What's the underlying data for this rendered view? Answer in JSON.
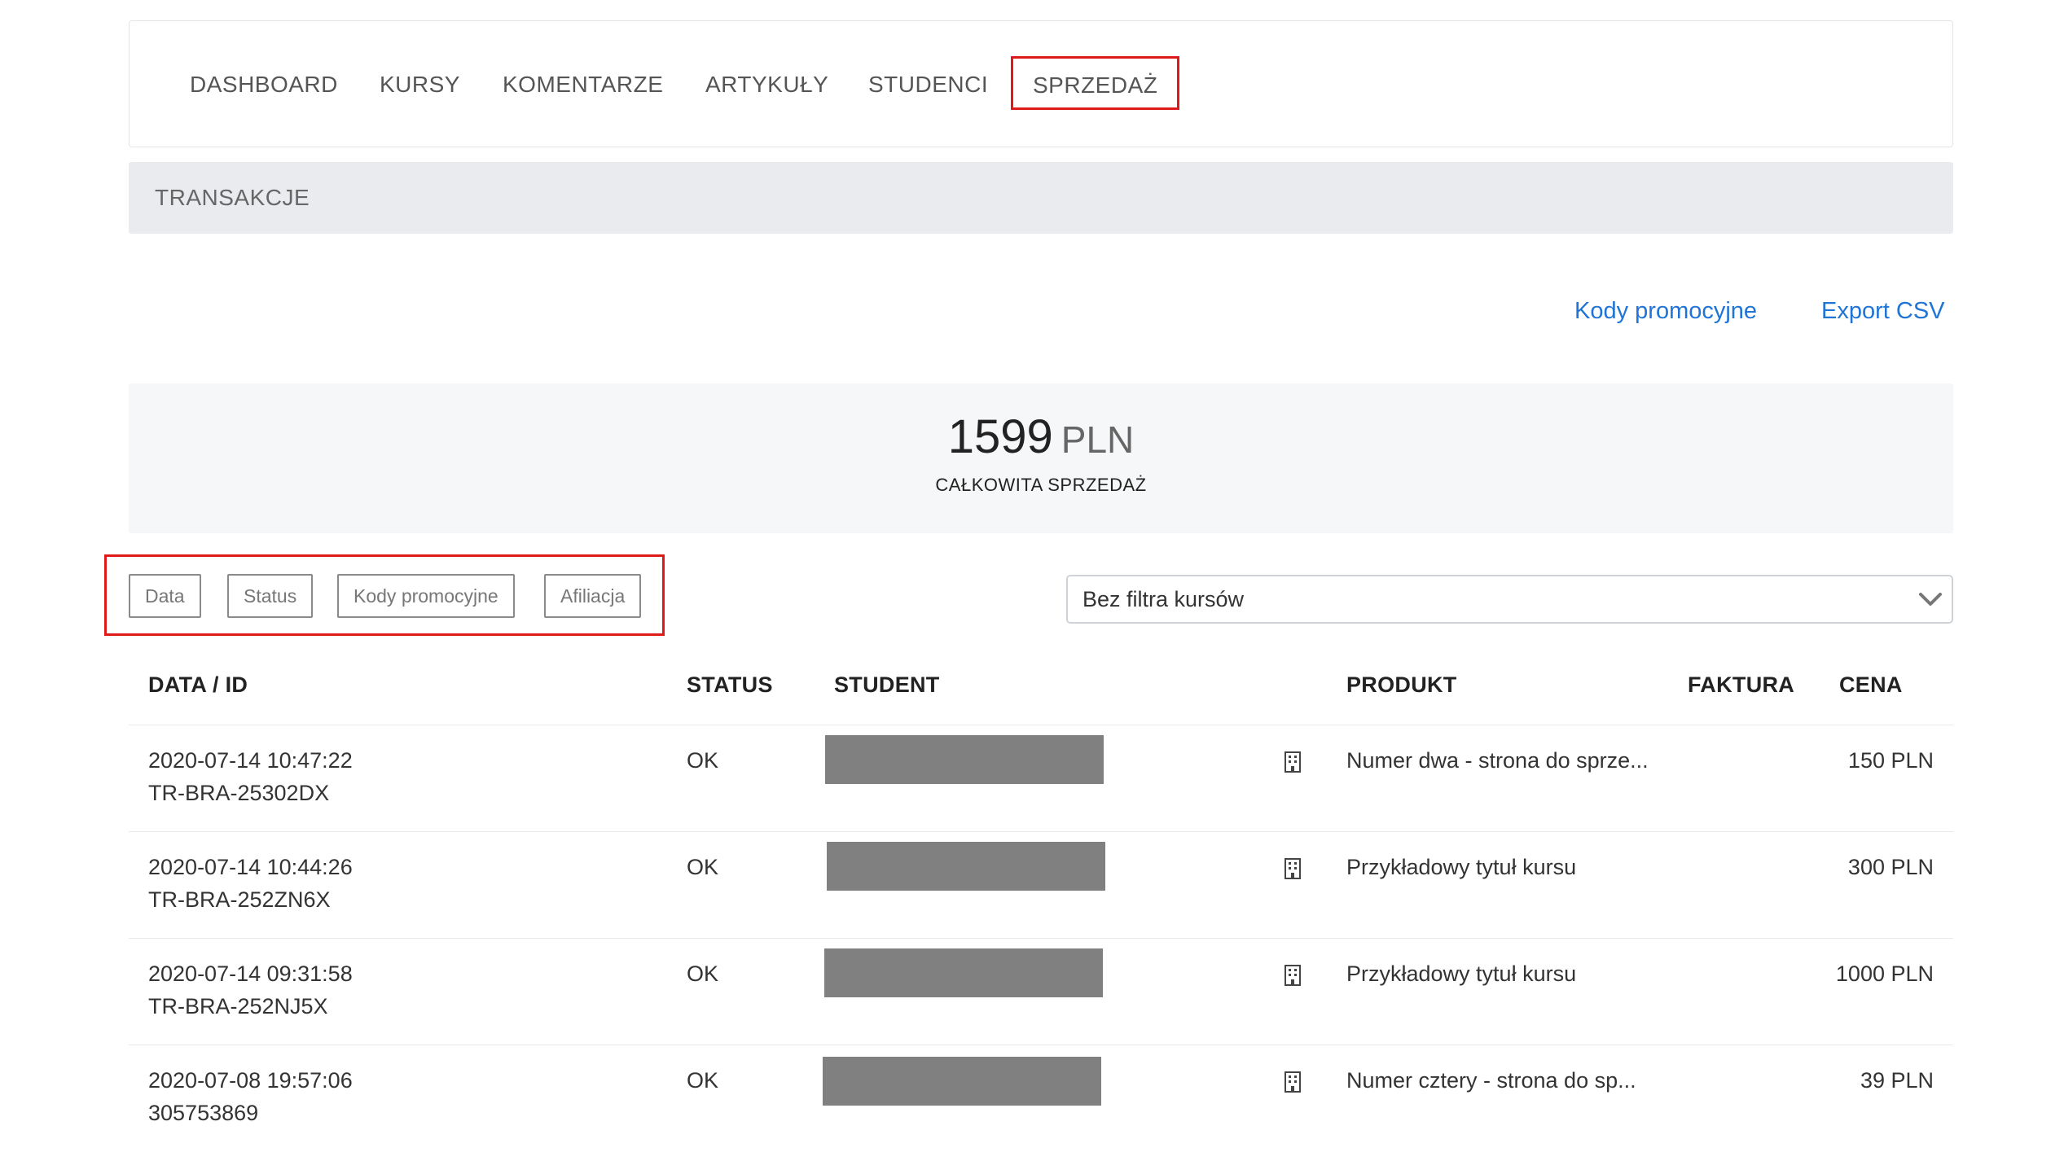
{
  "nav": {
    "items": [
      {
        "label": "DASHBOARD"
      },
      {
        "label": "KURSY"
      },
      {
        "label": "KOMENTARZE"
      },
      {
        "label": "ARTYKUŁY"
      },
      {
        "label": "STUDENCI"
      },
      {
        "label": "SPRZEDAŻ",
        "active": true
      }
    ]
  },
  "section": {
    "title": "TRANSAKCJE"
  },
  "links": {
    "promo_codes": "Kody promocyjne",
    "export_csv": "Export CSV"
  },
  "summary": {
    "amount": "1599",
    "currency": "PLN",
    "label": "CAŁKOWITA SPRZEDAŻ"
  },
  "filters": {
    "buttons": [
      "Data",
      "Status",
      "Kody promocyjne",
      "Afiliacja"
    ]
  },
  "course_filter": {
    "value": "Bez filtra kursów"
  },
  "table": {
    "headers": {
      "date_id": "DATA / ID",
      "status": "STATUS",
      "student": "STUDENT",
      "product": "PRODUKT",
      "invoice": "FAKTURA",
      "price": "CENA"
    },
    "rows": [
      {
        "date": "2020-07-14 10:47:22",
        "id": "TR-BRA-25302DX",
        "status": "OK",
        "product": "Numer dwa - strona do sprze...",
        "price": "150 PLN"
      },
      {
        "date": "2020-07-14 10:44:26",
        "id": "TR-BRA-252ZN6X",
        "status": "OK",
        "product": "Przykładowy tytuł kursu",
        "price": "300 PLN"
      },
      {
        "date": "2020-07-14 09:31:58",
        "id": "TR-BRA-252NJ5X",
        "status": "OK",
        "product": "Przykładowy tytuł kursu",
        "price": "1000 PLN"
      },
      {
        "date": "2020-07-08 19:57:06",
        "id": "305753869",
        "status": "OK",
        "product": "Numer cztery - strona do sp...",
        "price": "39 PLN"
      }
    ]
  },
  "colors": {
    "accent_link": "#1f74d6",
    "highlight_box": "#e01919",
    "redaction": "#808080"
  },
  "icons": {
    "invoice": "building-icon",
    "dropdown": "chevron-down-icon"
  }
}
